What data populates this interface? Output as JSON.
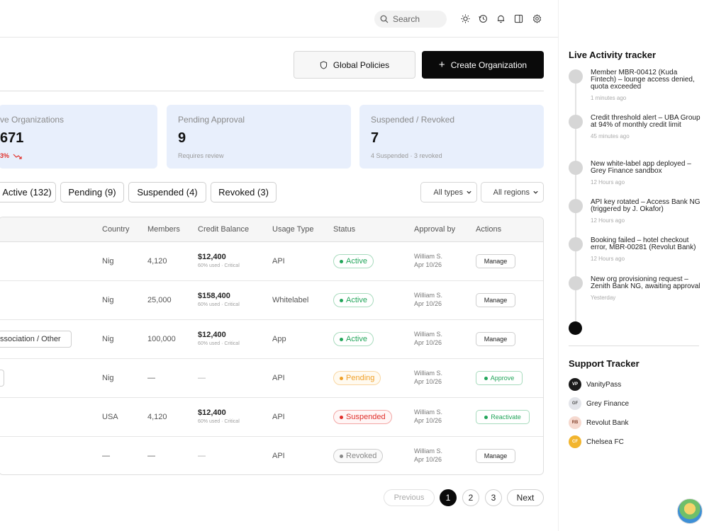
{
  "topbar": {
    "search_placeholder": "Search"
  },
  "header": {
    "global_policies": "Global Policies",
    "create_org": "Create Organization"
  },
  "cards": [
    {
      "label": "ve Organizations",
      "value": "671",
      "sub": "3%"
    },
    {
      "label": "Pending Approval",
      "value": "9",
      "sub": "Requires review"
    },
    {
      "label": "Suspended / Revoked",
      "value": "7",
      "sub": "4 Suspended · 3 revoked"
    }
  ],
  "filters": {
    "chips": [
      "Active (132)",
      "Pending (9)",
      "Suspended (4)",
      "Revoked (3)"
    ],
    "type_select": "All types",
    "region_select": "All regions"
  },
  "table": {
    "headers": [
      "Country",
      "Members",
      "Credit Balance",
      "Usage Type",
      "Status",
      "Approval by",
      "Actions"
    ],
    "assoc_label": "ssociation / Other",
    "rows": [
      {
        "country": "Nig",
        "members": "4,120",
        "amount": "$12,400",
        "amount_sub": "60% used · Critical",
        "usage": "API",
        "status": "Active",
        "approver": "William S.",
        "date": "Apr 10/26",
        "action": "Manage"
      },
      {
        "country": "Nig",
        "members": "25,000",
        "amount": "$158,400",
        "amount_sub": "60% used · Critical",
        "usage": "Whitelabel",
        "status": "Active",
        "approver": "William S.",
        "date": "Apr 10/26",
        "action": "Manage"
      },
      {
        "country": "Nig",
        "members": "100,000",
        "amount": "$12,400",
        "amount_sub": "60% used · Critical",
        "usage": "App",
        "status": "Active",
        "approver": "William S.",
        "date": "Apr 10/26",
        "action": "Manage"
      },
      {
        "country": "Nig",
        "members": "—",
        "amount": "—",
        "amount_sub": "",
        "usage": "API",
        "status": "Pending",
        "approver": "William S.",
        "date": "Apr 10/26",
        "action": "Approve"
      },
      {
        "country": "USA",
        "members": "4,120",
        "amount": "$12,400",
        "amount_sub": "60% used · Critical",
        "usage": "API",
        "status": "Suspended",
        "approver": "William S.",
        "date": "Apr 10/26",
        "action": "Reactivate"
      },
      {
        "country": "—",
        "members": "—",
        "amount": "—",
        "amount_sub": "",
        "usage": "API",
        "status": "Revoked",
        "approver": "William S.",
        "date": "Apr 10/26",
        "action": "Manage"
      }
    ]
  },
  "pagination": {
    "prev": "Previous",
    "pages": [
      "1",
      "2",
      "3"
    ],
    "next": "Next",
    "current": "1"
  },
  "activity": {
    "title": "Live Activity tracker",
    "items": [
      {
        "text": "Member MBR-00412 (Kuda Fintech) – lounge access denied, quota exceeded",
        "time": "1 minutes ago"
      },
      {
        "text": "Credit threshold alert – UBA Group at 94% of monthly credit limit",
        "time": "45 minutes ago"
      },
      {
        "text": "New white-label app deployed – Grey Finance sandbox",
        "time": "12 Hours ago"
      },
      {
        "text": "API key rotated – Access Bank NG (triggered by J. Okafor)",
        "time": "12 Hours ago"
      },
      {
        "text": "Booking failed – hotel checkout error, MBR-00281 (Revolut Bank)",
        "time": "12 Hours ago"
      },
      {
        "text": "New org provisioning request – Zenith Bank NG, awaiting approval",
        "time": "Yesterday"
      }
    ]
  },
  "support": {
    "title": "Support Tracker",
    "items": [
      {
        "initials": "VP",
        "name": "VanityPass",
        "bg": "#1a1a1a",
        "fg": "#ffffff"
      },
      {
        "initials": "GF",
        "name": "Grey Finance",
        "bg": "#e3e5ea",
        "fg": "#555555"
      },
      {
        "initials": "RB",
        "name": "Revolut Bank",
        "bg": "#f6d9cf",
        "fg": "#8a4a35"
      },
      {
        "initials": "CF",
        "name": "Chelsea FC",
        "bg": "#f2b52e",
        "fg": "#ffffff"
      }
    ]
  },
  "colors": {
    "active": "#22a55a",
    "pending": "#f0a12a",
    "suspended": "#e0302b",
    "revoked": "#888888",
    "trend_down": "#e0302b"
  }
}
